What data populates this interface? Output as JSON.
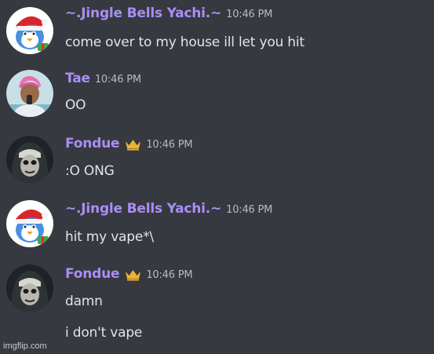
{
  "messages": [
    {
      "username": "~.Jingle Bells Yachi.~",
      "username_color": "#a98ef5",
      "avatar_icon": "santa-penguin-avatar",
      "timestamp": "10:46 PM",
      "crown": false,
      "lines": [
        "come over to my house ill let you hit"
      ]
    },
    {
      "username": "Tae",
      "username_color": "#a98ef5",
      "avatar_icon": "pink-hair-person-avatar",
      "timestamp": "10:46 PM",
      "crown": false,
      "lines": [
        "OO"
      ]
    },
    {
      "username": "Fondue",
      "username_color": "#a98ef5",
      "avatar_icon": "nun-mask-avatar",
      "timestamp": "10:46 PM",
      "crown": true,
      "crown_color": "#f0b232",
      "lines": [
        ":O ONG"
      ]
    },
    {
      "username": "~.Jingle Bells Yachi.~",
      "username_color": "#a98ef5",
      "avatar_icon": "santa-penguin-avatar",
      "timestamp": "10:46 PM",
      "crown": false,
      "lines": [
        "hit my vape*\\"
      ]
    },
    {
      "username": "Fondue",
      "username_color": "#a98ef5",
      "avatar_icon": "nun-mask-avatar",
      "timestamp": "10:46 PM",
      "crown": true,
      "crown_color": "#f0b232",
      "lines": [
        "damn",
        "i don't vape"
      ]
    }
  ],
  "watermark": "imgflip.com"
}
